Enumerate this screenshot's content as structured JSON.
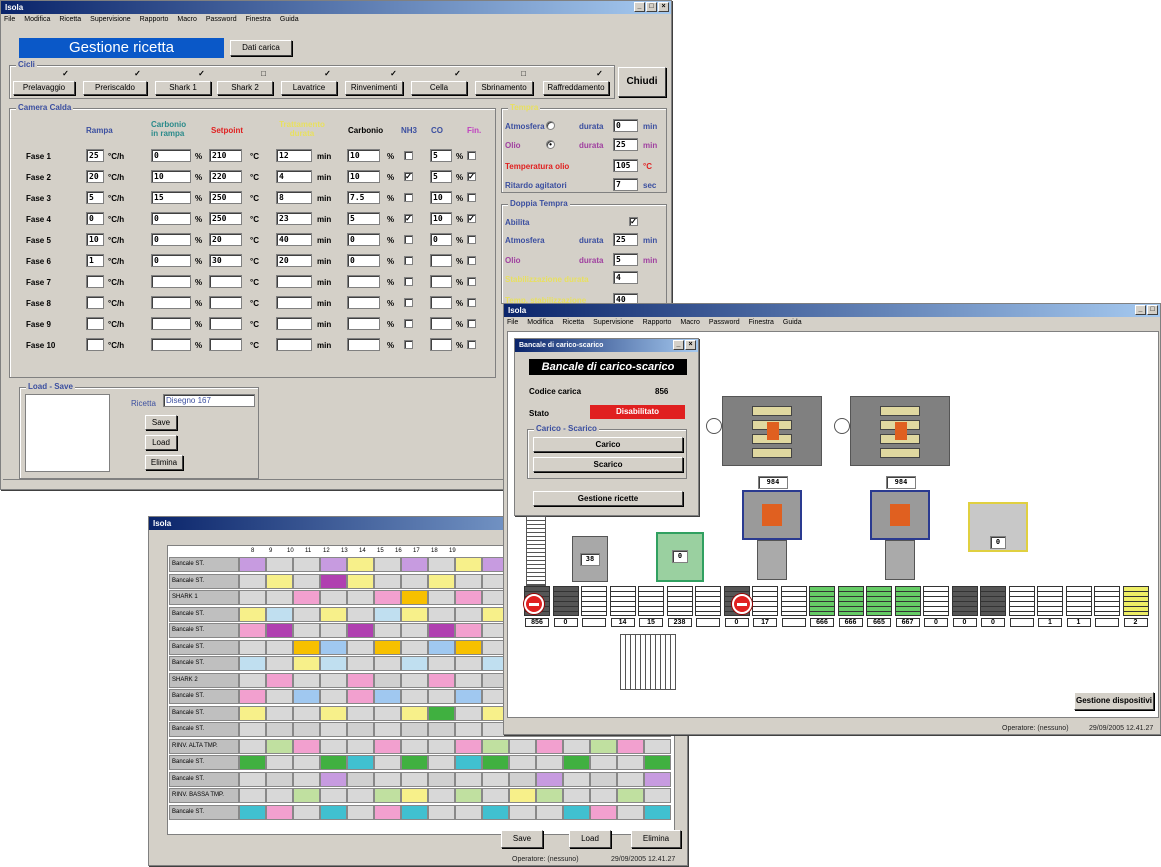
{
  "app_title": "Isola",
  "menu": [
    "File",
    "Modifica",
    "Ricetta",
    "Supervisione",
    "Rapporto",
    "Macro",
    "Password",
    "Finestra",
    "Guida"
  ],
  "recipe": {
    "header": "Gestione ricetta",
    "dati_carica": "Dati carica",
    "close": "Chiudi",
    "cicli_label": "Cicli",
    "cicli": [
      {
        "label": "Prelavaggio",
        "checked": true
      },
      {
        "label": "Preriscaldo",
        "checked": true
      },
      {
        "label": "Shark 1",
        "checked": true
      },
      {
        "label": "Shark 2",
        "checked": false
      },
      {
        "label": "Lavatrice",
        "checked": true
      },
      {
        "label": "Rinvenimenti",
        "checked": true
      },
      {
        "label": "Cella",
        "checked": true
      },
      {
        "label": "Sbrinamento",
        "checked": false
      },
      {
        "label": "Raffreddamento",
        "checked": true
      }
    ],
    "camera_label": "Camera Calda",
    "cols": {
      "rampa": "Rampa",
      "carbonio_rampa": "Carbonio in rampa",
      "setpoint": "Setpoint",
      "trattamento": "Trattamento durata",
      "carbonio": "Carbonio",
      "nh3": "NH3",
      "co": "CO",
      "fin": "Fin."
    },
    "units": {
      "rampa": "°C/h",
      "pct": "%",
      "deg": "°C",
      "min": "min"
    },
    "phases": [
      {
        "name": "Fase 1",
        "r": "25",
        "cr": "0",
        "sp": "210",
        "t": "12",
        "c": "10",
        "nh3": false,
        "co": "5",
        "fin": false
      },
      {
        "name": "Fase 2",
        "r": "20",
        "cr": "10",
        "sp": "220",
        "t": "4",
        "c": "10",
        "nh3": true,
        "co": "5",
        "fin": true
      },
      {
        "name": "Fase 3",
        "r": "5",
        "cr": "15",
        "sp": "250",
        "t": "8",
        "c": "7.5",
        "nh3": false,
        "co": "10",
        "fin": false
      },
      {
        "name": "Fase 4",
        "r": "0",
        "cr": "0",
        "sp": "250",
        "t": "23",
        "c": "5",
        "nh3": true,
        "co": "10",
        "fin": true
      },
      {
        "name": "Fase 5",
        "r": "10",
        "cr": "0",
        "sp": "20",
        "t": "40",
        "c": "0",
        "nh3": false,
        "co": "0",
        "fin": false
      },
      {
        "name": "Fase 6",
        "r": "1",
        "cr": "0",
        "sp": "30",
        "t": "20",
        "c": "0",
        "nh3": false,
        "co": "",
        "fin": false
      },
      {
        "name": "Fase 7",
        "r": "",
        "cr": "",
        "sp": "",
        "t": "",
        "c": "",
        "nh3": false,
        "co": "",
        "fin": false
      },
      {
        "name": "Fase 8",
        "r": "",
        "cr": "",
        "sp": "",
        "t": "",
        "c": "",
        "nh3": false,
        "co": "",
        "fin": false
      },
      {
        "name": "Fase 9",
        "r": "",
        "cr": "",
        "sp": "",
        "t": "",
        "c": "",
        "nh3": false,
        "co": "",
        "fin": false
      },
      {
        "name": "Fase 10",
        "r": "",
        "cr": "",
        "sp": "",
        "t": "",
        "c": "",
        "nh3": false,
        "co": "",
        "fin": false
      }
    ],
    "tempra": {
      "label": "Tempra",
      "atm": "Atmosfera",
      "durata": "durata",
      "atm_val": "0",
      "olio": "Olio",
      "olio_val": "25",
      "temp_olio": "Temperatura olio",
      "temp_olio_val": "105",
      "rit": "Ritardo agitatori",
      "rit_val": "7",
      "sec": "sec"
    },
    "doppia": {
      "label": "Doppia Tempra",
      "abilita": "Abilita",
      "atm": "Atmosfera",
      "atm_val": "25",
      "olio": "Olio",
      "olio_val": "5",
      "stab": "Stabilizzazione durata",
      "stab_val": "4",
      "temp_stab": "Temp. stabilizzazione",
      "temp_stab_val": "40"
    },
    "load": {
      "label": "Load - Save",
      "ricetta": "Ricetta",
      "ricetta_val": "Disegno 167",
      "save": "Save",
      "load": "Load",
      "elimina": "Elimina"
    }
  },
  "bancale": {
    "title": "Bancale di carico-scarico",
    "header": "Bancale di carico-scarico",
    "codice": "Codice carica",
    "codice_val": "856",
    "stato": "Stato",
    "stato_val": "Disabilitato",
    "group": "Carico - Scarico",
    "carico": "Carico",
    "scarico": "Scarico",
    "gestione": "Gestione ricette"
  },
  "plant": {
    "furnace_a": "984",
    "furnace_b": "984",
    "wash": "0",
    "shark": "0",
    "pre": "38",
    "conveyor": [
      "856",
      "0",
      "",
      "14",
      "15",
      "238",
      "",
      "0",
      "17",
      "",
      "666",
      "666",
      "665",
      "667",
      "0",
      "0",
      "0",
      "",
      "1",
      "1",
      "",
      "2"
    ],
    "gestione_disp": "Gestione dispositivi",
    "operator": "Operatore: (nessuno)",
    "datetime": "29/09/2005 12.41.27"
  },
  "schedule": {
    "hours": [
      "8",
      "9",
      "10",
      "11",
      "12",
      "13",
      "14",
      "15",
      "16",
      "17",
      "18",
      "19"
    ],
    "rows": [
      "Bancale ST.",
      "Bancale ST.",
      "SHARK 1",
      "Bancale ST.",
      "Bancale ST.",
      "Bancale ST.",
      "Bancale ST.",
      "SHARK 2",
      "Bancale ST.",
      "Bancale ST.",
      "Bancale ST.",
      "RINV. ALTA TMP.",
      "Bancale ST.",
      "Bancale ST.",
      "RINV. BASSA TMP.",
      "Bancale ST."
    ],
    "save": "Save",
    "load": "Load",
    "elimina": "Elimina",
    "operator": "Operatore: (nessuno)",
    "datetime": "29/09/2005 12.41.27"
  }
}
